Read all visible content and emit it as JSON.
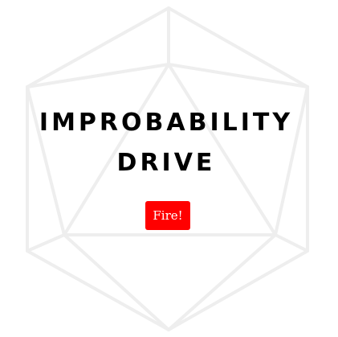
{
  "title": {
    "line1": "IMPROBABILITY",
    "line2": "DRIVE"
  },
  "fire_button": {
    "label": "Fire!"
  },
  "colors": {
    "button_bg": "#ff0000",
    "button_text": "#ffffff",
    "title_text": "#000000",
    "die_outline": "#eeeeee"
  },
  "icons": {
    "background": "d20-icosahedron-outline-icon"
  }
}
